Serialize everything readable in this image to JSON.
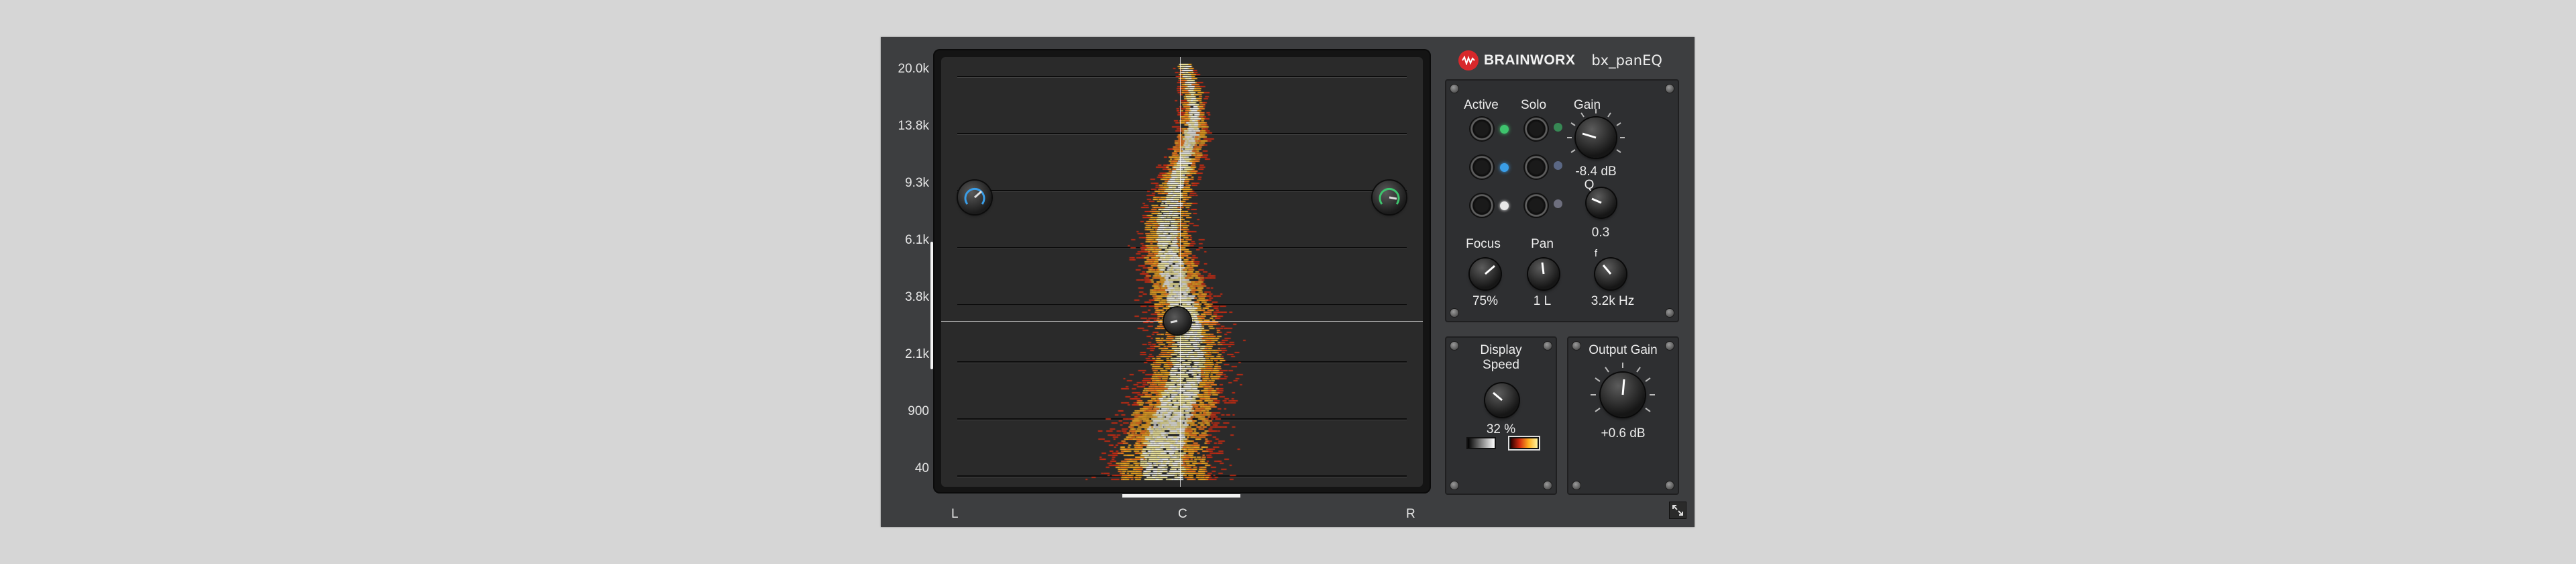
{
  "brand": {
    "name": "BRAINWORX",
    "plugin": "bx_panEQ",
    "logo_color": "#d8282b",
    "logo_icon": "waveform-icon"
  },
  "frequency_labels": [
    "20.0k",
    "13.8k",
    "9.3k",
    "6.1k",
    "3.8k",
    "2.1k",
    "900",
    "40"
  ],
  "pan_labels": {
    "left": "L",
    "center": "C",
    "right": "R"
  },
  "band_controls": {
    "active_label": "Active",
    "solo_label": "Solo",
    "gain_label": "Gain",
    "gain_value": "-8.4 dB",
    "q_label": "Q",
    "q_value": "0.3",
    "focus_label": "Focus",
    "focus_value": "75%",
    "pan_label": "Pan",
    "pan_value": "1 L",
    "freq_label": "f",
    "freq_value": "3.2k Hz",
    "bands": [
      {
        "led_color": "#3ec46d"
      },
      {
        "led_color": "#3a9ee8"
      },
      {
        "led_color": "#e8e8e8"
      }
    ]
  },
  "display_speed": {
    "label_line1": "Display",
    "label_line2": "Speed",
    "value": "32 %"
  },
  "output_gain": {
    "label": "Output Gain",
    "value": "+0.6 dB"
  },
  "colors": {
    "background": "#3d3e40",
    "display": "#2a2a2a",
    "heat_hot": "#fff3a0",
    "heat_mid": "#ffb020",
    "heat_low": "#d42a10"
  }
}
